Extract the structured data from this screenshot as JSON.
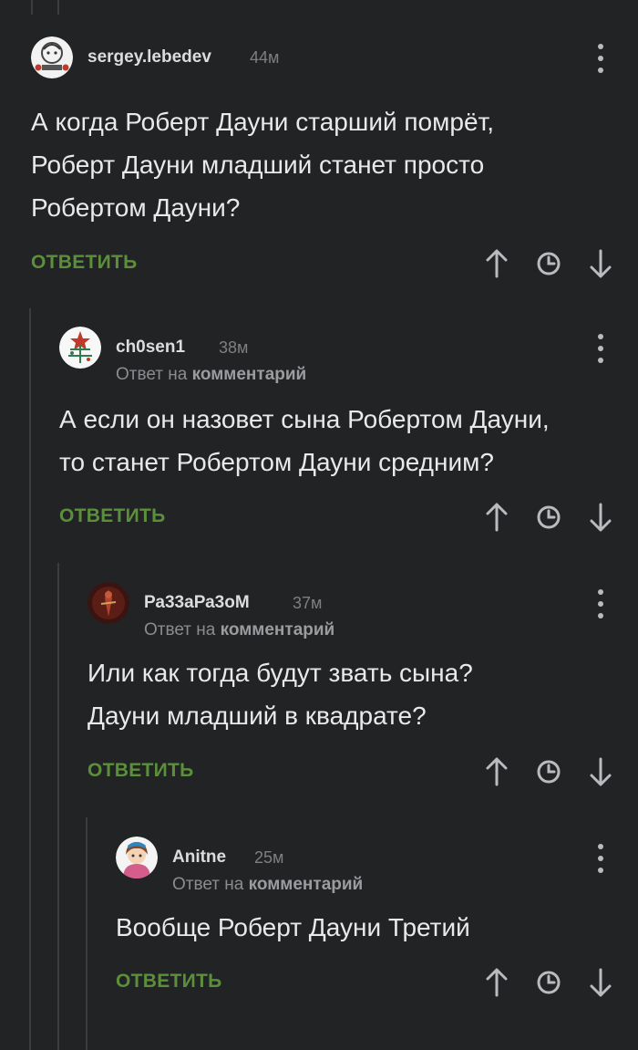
{
  "comments": [
    {
      "username": "sergey.lebedev",
      "time": "44м",
      "text_lines": [
        "А когда Роберт Дауни старший помрёт,",
        "Роберт Дауни младший станет просто",
        "Робертом Дауни?"
      ],
      "reply_label": "ОТВЕТИТЬ"
    },
    {
      "username": "ch0sen1",
      "time": "38м",
      "reply_to_prefix": "Ответ на",
      "reply_to_target": "комментарий",
      "text_lines": [
        "А если он назовет сына Робертом Дауни,",
        "то станет Робертом Дауни средним?"
      ],
      "reply_label": "ОТВЕТИТЬ"
    },
    {
      "username": "Ра33аРа3оМ",
      "time": "37м",
      "reply_to_prefix": "Ответ на",
      "reply_to_target": "комментарий",
      "text_lines": [
        "Или как тогда будут звать сына?",
        "Дауни младший в квадрате?"
      ],
      "reply_label": "ОТВЕТИТЬ"
    },
    {
      "username": "Anitne",
      "time": "25м",
      "reply_to_prefix": "Ответ на",
      "reply_to_target": "комментарий",
      "text_lines": [
        "Вообще Роберт Дауни Третий"
      ],
      "reply_label": "ОТВЕТИТЬ"
    }
  ],
  "icons": {
    "menu": "more-vertical-icon",
    "upvote": "arrow-up-icon",
    "save": "clock-icon",
    "downvote": "arrow-down-icon"
  },
  "colors": {
    "background": "#222325",
    "reply_green": "#5b8f3a",
    "text": "#e9e9e9",
    "muted": "#7d7f82"
  }
}
